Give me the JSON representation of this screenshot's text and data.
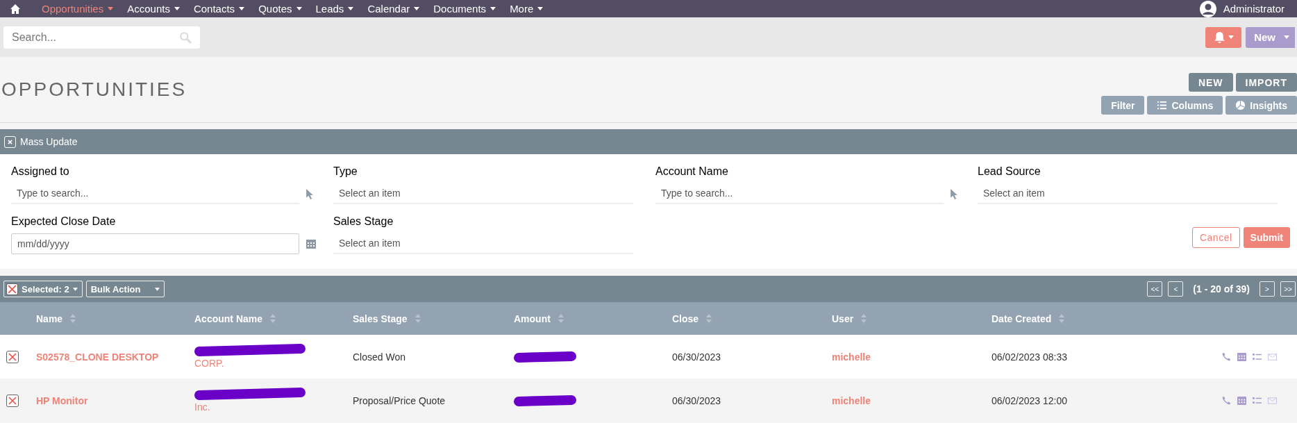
{
  "nav": {
    "items": [
      {
        "label": "Opportunities",
        "selected": true
      },
      {
        "label": "Accounts",
        "selected": false
      },
      {
        "label": "Contacts",
        "selected": false
      },
      {
        "label": "Quotes",
        "selected": false
      },
      {
        "label": "Leads",
        "selected": false
      },
      {
        "label": "Calendar",
        "selected": false
      },
      {
        "label": "Documents",
        "selected": false
      },
      {
        "label": "More",
        "selected": false
      }
    ],
    "user": "Administrator"
  },
  "search": {
    "placeholder": "Search..."
  },
  "quick_create": {
    "label": "New"
  },
  "page": {
    "title": "OPPORTUNITIES",
    "actions": [
      "NEW",
      "IMPORT"
    ],
    "tools": [
      "Filter",
      "Columns",
      "Insights"
    ]
  },
  "mass_update": {
    "title": "Mass Update",
    "fields": [
      {
        "label": "Assigned to",
        "kind": "search",
        "placeholder": "Type to search..."
      },
      {
        "label": "Type",
        "kind": "select",
        "placeholder": "Select an item"
      },
      {
        "label": "Account Name",
        "kind": "search",
        "placeholder": "Type to search..."
      },
      {
        "label": "Lead Source",
        "kind": "select",
        "placeholder": "Select an item"
      },
      {
        "label": "Expected Close Date",
        "kind": "date",
        "placeholder": "mm/dd/yyyy"
      },
      {
        "label": "Sales Stage",
        "kind": "select",
        "placeholder": "Select an item"
      }
    ],
    "cancel": "Cancel",
    "submit": "Submit"
  },
  "list": {
    "selected_label": "Selected: 2",
    "bulk_action": "Bulk Action",
    "pagination": {
      "first": "<<",
      "prev": "<",
      "range": "(1 - 20 of 39)",
      "next": ">",
      "last": ">>"
    },
    "columns": [
      "Name",
      "Account Name",
      "Sales Stage",
      "Amount",
      "Close",
      "User",
      "Date Created"
    ],
    "rows": [
      {
        "checked": true,
        "name": "S02578_CLONE DESKTOP",
        "account_redacted": true,
        "account": "CORP.",
        "sales_stage": "Closed Won",
        "amount_redacted": true,
        "close": "06/30/2023",
        "user": "michelle",
        "date_created": "06/02/2023 08:33"
      },
      {
        "checked": true,
        "name": "HP Monitor",
        "account_redacted": true,
        "account": "Inc.",
        "sales_stage": "Proposal/Price Quote",
        "amount_redacted": true,
        "close": "06/30/2023",
        "user": "michelle",
        "date_created": "06/02/2023 12:00"
      }
    ]
  }
}
